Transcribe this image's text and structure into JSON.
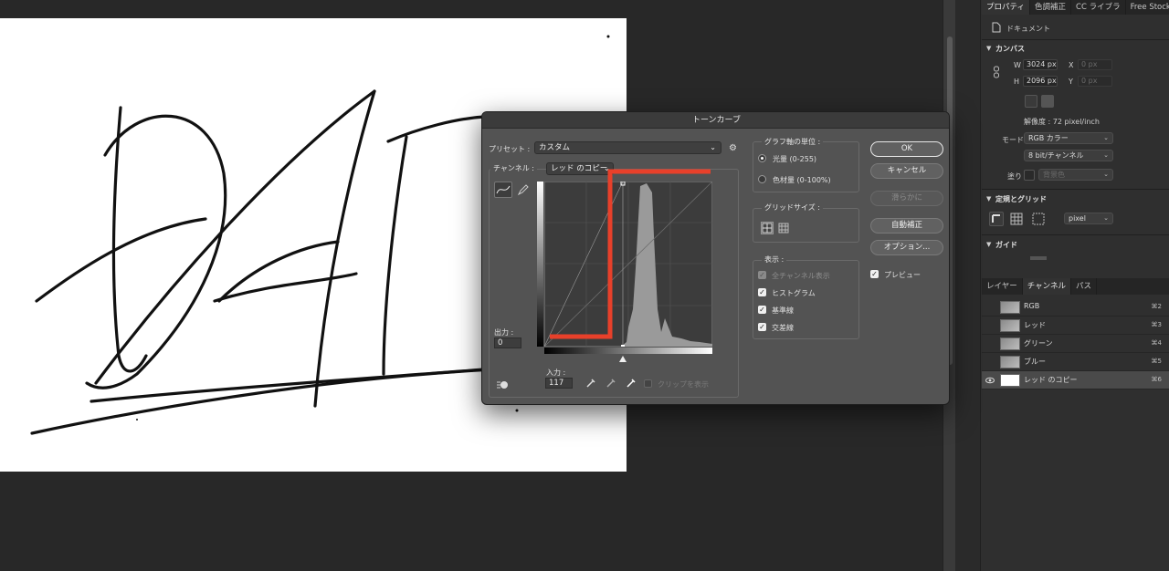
{
  "panel": {
    "tabs": [
      "プロパティ",
      "色調補正",
      "CC ライブラ",
      "Free Stock"
    ],
    "doc_label": "ドキュメント",
    "canvas_section": "カンバス",
    "w_label": "W",
    "w_value": "3024 px",
    "x_label": "X",
    "x_value": "0 px",
    "h_label": "H",
    "h_value": "2096 px",
    "y_label": "Y",
    "y_value": "0 px",
    "resolution": "解像度 : 72 pixel/inch",
    "mode_label": "モード",
    "mode_value": "RGB カラー",
    "bit_value": "8 bit/チャンネル",
    "fill_label": "塗り",
    "fill_value": "背景色",
    "rulers_section": "定規とグリッド",
    "unit_value": "pixel",
    "guides_section": "ガイド",
    "layer_tabs": [
      "レイヤー",
      "チャンネル",
      "パス"
    ],
    "channels": [
      {
        "name": "RGB",
        "key": "⌘2"
      },
      {
        "name": "レッド",
        "key": "⌘3"
      },
      {
        "name": "グリーン",
        "key": "⌘4"
      },
      {
        "name": "ブルー",
        "key": "⌘5"
      },
      {
        "name": "レッド のコピー",
        "key": "⌘6"
      }
    ]
  },
  "dialog": {
    "title": "トーンカーブ",
    "preset_label": "プリセット :",
    "preset_value": "カスタム",
    "channel_label": "チャンネル :",
    "channel_value": "レッド のコピー",
    "output_label": "出力 :",
    "output_value": "0",
    "input_label": "入力 :",
    "input_value": "117",
    "clip_label": "クリップを表示",
    "buttons": {
      "ok": "OK",
      "cancel": "キャンセル",
      "smooth": "滑らかに",
      "auto": "自動補正",
      "options": "オプション..."
    },
    "preview_label": "プレビュー",
    "graph_unit_group": "グラフ軸の単位 :",
    "unit_light": "光量 (0-255)",
    "unit_pigment": "色材量 (0-100%)",
    "grid_group": "グリッドサイズ :",
    "show_group": "表示 :",
    "show_items": [
      "全チャンネル表示",
      "ヒストグラム",
      "基準線",
      "交差線"
    ]
  },
  "colors": {
    "curve_red": "#e8402a",
    "accent": "#ffffff"
  }
}
